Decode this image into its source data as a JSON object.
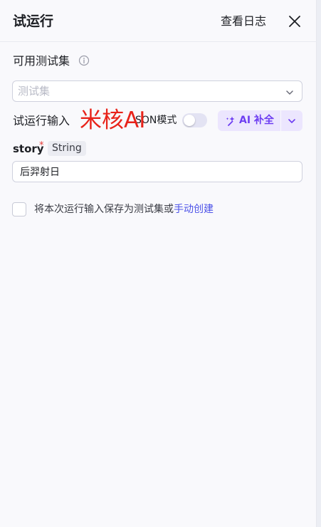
{
  "header": {
    "title": "试运行",
    "view_log": "查看日志"
  },
  "testset": {
    "label": "可用测试集",
    "placeholder": "测试集"
  },
  "run_input": {
    "label": "试运行输入",
    "json_mode_label": "SON模式",
    "json_mode_on": false,
    "ai_button_label": "AI 补全"
  },
  "watermark": "米核AI",
  "fields": [
    {
      "name": "story",
      "required_mark": "*",
      "type": "String",
      "value": "后羿射日"
    }
  ],
  "save_option": {
    "checked": false,
    "text": "将本次运行输入保存为测试集或",
    "link_text": "手动创建"
  },
  "colors": {
    "accent": "#6d3df2",
    "link": "#4d53e8",
    "watermark": "#e8231a",
    "panel_bg": "#f9f9fc"
  }
}
